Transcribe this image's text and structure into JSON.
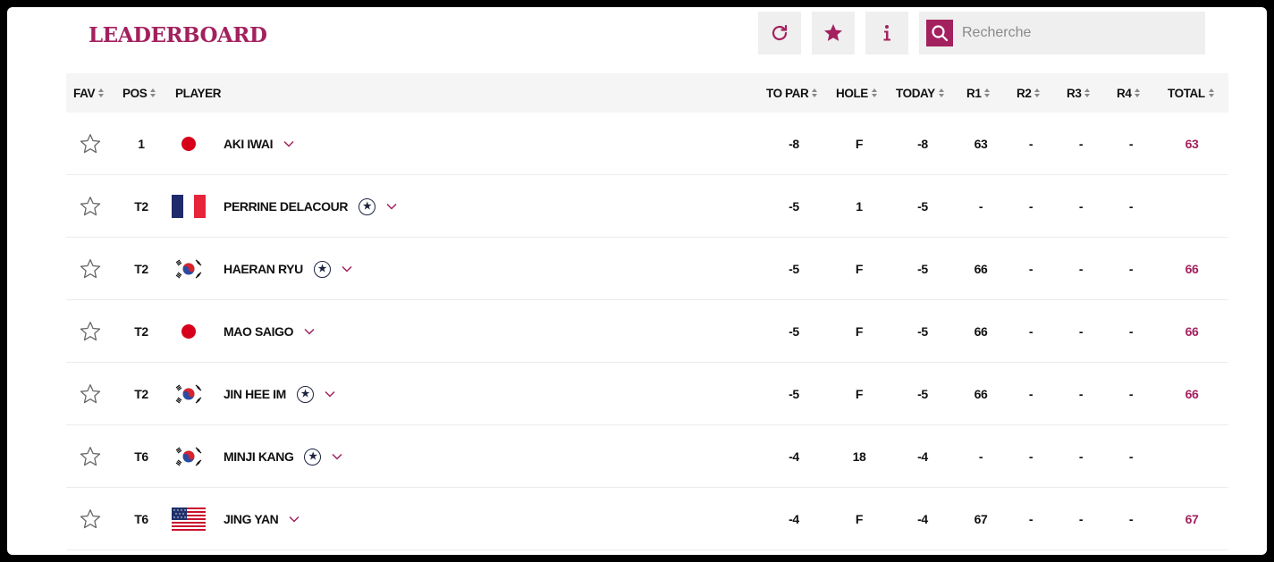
{
  "header": {
    "title": "LEADERBOARD",
    "refresh_icon": "refresh-icon",
    "favorites_icon": "star-icon",
    "info_icon": "info-icon",
    "search_placeholder": "Recherche"
  },
  "colors": {
    "accent": "#a3215e",
    "rookie": "#1c2340"
  },
  "columns": {
    "fav": "FAV",
    "pos": "POS",
    "player": "PLAYER",
    "to_par": "TO PAR",
    "hole": "HOLE",
    "today": "TODAY",
    "r1": "R1",
    "r2": "R2",
    "r3": "R3",
    "r4": "R4",
    "total": "TOTAL"
  },
  "players": [
    {
      "pos": "1",
      "flag": "japan",
      "name": "AKI IWAI",
      "rookie": false,
      "to_par": "-8",
      "hole": "F",
      "today": "-8",
      "r1": "63",
      "r2": "-",
      "r3": "-",
      "r4": "-",
      "total": "63"
    },
    {
      "pos": "T2",
      "flag": "france",
      "name": "PERRINE DELACOUR",
      "rookie": true,
      "to_par": "-5",
      "hole": "1",
      "today": "-5",
      "r1": "-",
      "r2": "-",
      "r3": "-",
      "r4": "-",
      "total": ""
    },
    {
      "pos": "T2",
      "flag": "korea",
      "name": "HAERAN RYU",
      "rookie": true,
      "to_par": "-5",
      "hole": "F",
      "today": "-5",
      "r1": "66",
      "r2": "-",
      "r3": "-",
      "r4": "-",
      "total": "66"
    },
    {
      "pos": "T2",
      "flag": "japan",
      "name": "MAO SAIGO",
      "rookie": false,
      "to_par": "-5",
      "hole": "F",
      "today": "-5",
      "r1": "66",
      "r2": "-",
      "r3": "-",
      "r4": "-",
      "total": "66"
    },
    {
      "pos": "T2",
      "flag": "korea",
      "name": "JIN HEE IM",
      "rookie": true,
      "to_par": "-5",
      "hole": "F",
      "today": "-5",
      "r1": "66",
      "r2": "-",
      "r3": "-",
      "r4": "-",
      "total": "66"
    },
    {
      "pos": "T6",
      "flag": "korea",
      "name": "MINJI KANG",
      "rookie": true,
      "to_par": "-4",
      "hole": "18",
      "today": "-4",
      "r1": "-",
      "r2": "-",
      "r3": "-",
      "r4": "-",
      "total": ""
    },
    {
      "pos": "T6",
      "flag": "usa",
      "name": "JING YAN",
      "rookie": false,
      "to_par": "-4",
      "hole": "F",
      "today": "-4",
      "r1": "67",
      "r2": "-",
      "r3": "-",
      "r4": "-",
      "total": "67"
    }
  ]
}
